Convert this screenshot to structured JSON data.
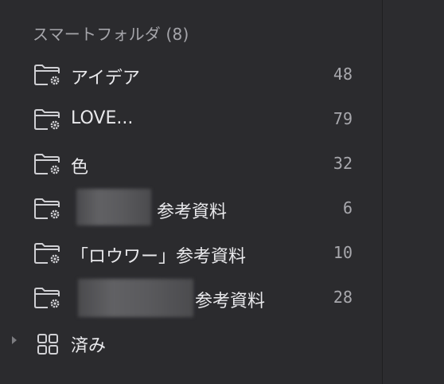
{
  "sidebar": {
    "section_title": "スマートフォルダ (8)",
    "items": [
      {
        "label": "アイデア",
        "count": "48",
        "icon": "smart-folder-icon"
      },
      {
        "label": "LOVE...",
        "count": "79",
        "icon": "smart-folder-icon"
      },
      {
        "label": "色",
        "count": "32",
        "icon": "smart-folder-icon"
      },
      {
        "label": "参考資料",
        "count": "6",
        "icon": "smart-folder-icon",
        "redacted_prefix": true
      },
      {
        "label": "「ロウワー」参考資料",
        "count": "10",
        "icon": "smart-folder-icon"
      },
      {
        "label": "参考資料",
        "count": "28",
        "icon": "smart-folder-icon",
        "redacted_prefix": true
      }
    ],
    "group": {
      "label": "済み",
      "icon": "grid-icon",
      "expanded": false
    }
  },
  "colors": {
    "background": "#2b2b2e",
    "text_primary": "#e9e9ec",
    "text_secondary": "#a5a5aa",
    "icon": "#d0d0d4"
  }
}
